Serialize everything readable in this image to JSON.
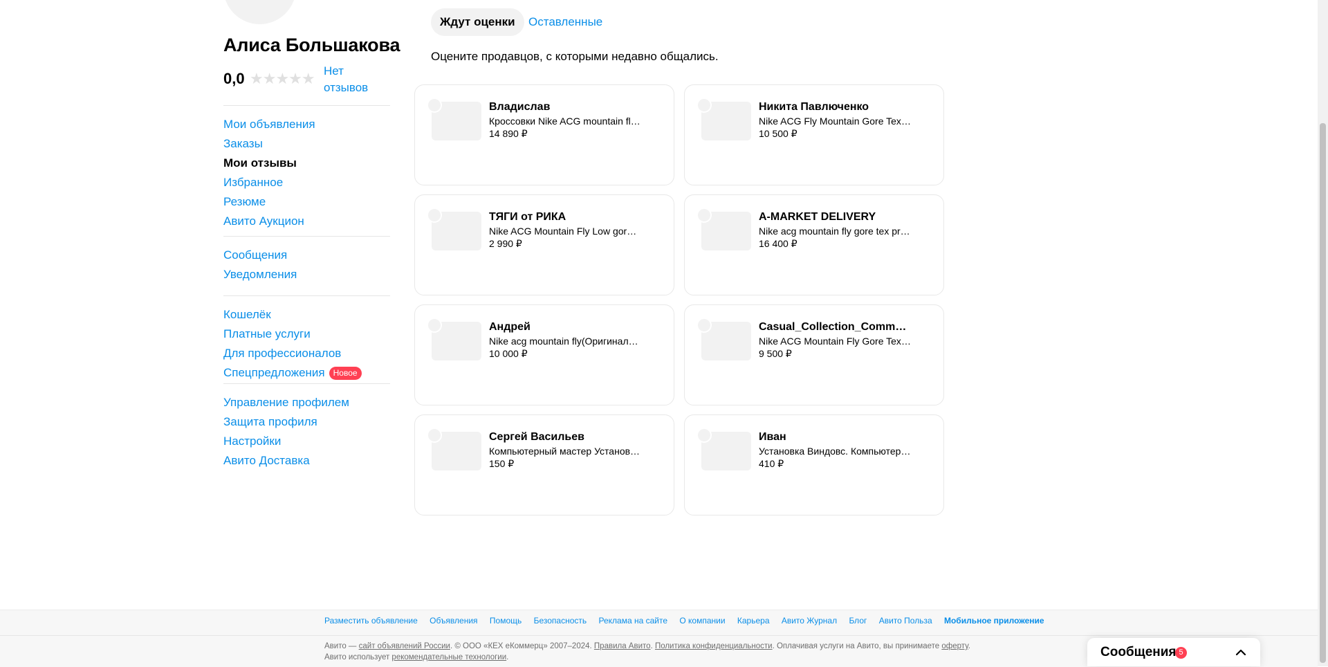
{
  "profile": {
    "name": "Алиса Большакова",
    "rating": "0,0",
    "stars": "★★★★★",
    "reviews_link": "Нет отзывов"
  },
  "menu": {
    "group1": [
      "Мои объявления",
      "Заказы",
      "Мои отзывы",
      "Избранное",
      "Резюме",
      "Авито Аукцион"
    ],
    "group2": [
      "Сообщения",
      "Уведомления"
    ],
    "group3": [
      "Кошелёк",
      "Платные услуги",
      "Для профессионалов",
      "Спецпредложения"
    ],
    "special_badge": "Новое",
    "group4": [
      "Управление профилем",
      "Защита профиля",
      "Настройки",
      "Авито Доставка"
    ]
  },
  "tabs": {
    "waiting": "Ждут оценки",
    "left": "Оставленные"
  },
  "subtitle": "Оцените продавцов, с которыми недавно общались.",
  "cards": [
    {
      "name": "Владислав",
      "desc": "Кроссовки Nike ACG mountain fly gore-tex",
      "price": "14 890 ₽"
    },
    {
      "name": "Никита Павлюченко",
      "desc": "Nike ACG Fly Mountain Gore Tex Оригинал",
      "price": "10 500 ₽"
    },
    {
      "name": "ТЯГИ от РИКА",
      "desc": "Nike ACG Mountain Fly Low gore-tex",
      "price": "2 990 ₽"
    },
    {
      "name": "A-MARKET DELIVERY",
      "desc": "Nike acg mountain fly gore tex premium",
      "price": "16 400 ₽"
    },
    {
      "name": "Андрей",
      "desc": "Nike acg mountain fly(Оригинал) gore-tex",
      "price": "10 000 ₽"
    },
    {
      "name": "Casual_Collection_Community",
      "desc": "Nike ACG Mountain Fly Gore Tex Low",
      "price": "9 500 ₽"
    },
    {
      "name": "Сергей Васильев",
      "desc": "Компьютерный мастер Установка Windows",
      "price": "150 ₽"
    },
    {
      "name": "Иван",
      "desc": "Установка Виндовс. Компьютерный мастер",
      "price": "410 ₽"
    }
  ],
  "footer": {
    "links": [
      "Разместить объявление",
      "Объявления",
      "Помощь",
      "Безопасность",
      "Реклама на сайте",
      "О компании",
      "Карьера",
      "Авито Журнал",
      "Блог",
      "Авито Польза",
      "Мобильное приложение"
    ],
    "legal": {
      "p1": "Авито — ",
      "l1": "сайт объявлений России",
      "p2": ". © ООО «КЕХ еКоммерц» 2007–2024. ",
      "l2": "Правила Авито",
      "p3": ". ",
      "l3": "Политика конфиденциальности",
      "p4": ". Оплачивая услуги на Авито, вы принимаете ",
      "l4": "оферту",
      "p5": ". Авито использует ",
      "l5": "рекомендательные технологии",
      "p6": "."
    }
  },
  "messenger": {
    "title": "Сообщения",
    "count": "5"
  }
}
